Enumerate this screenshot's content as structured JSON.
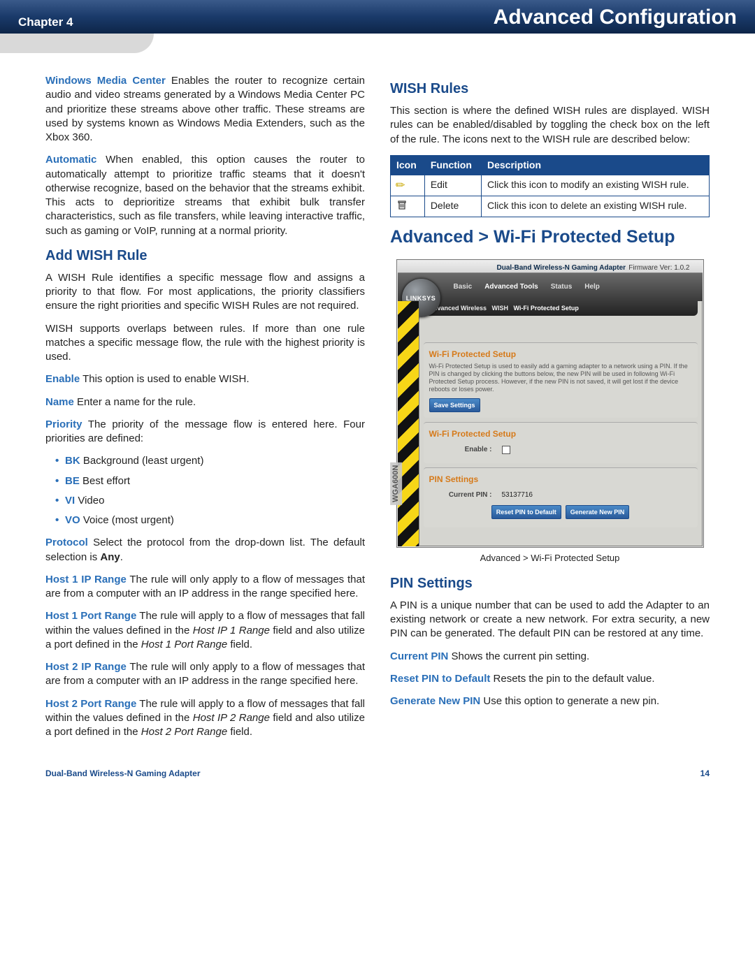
{
  "header": {
    "chapter": "Chapter 4",
    "title": "Advanced Configuration"
  },
  "left": {
    "wmc_label": "Windows Media Center",
    "wmc_text": "  Enables the router to recognize certain audio and video streams generated by a Windows Media Center PC and prioritize these streams above other traffic. These streams are used by systems known as Windows Media Extenders, such as the Xbox 360.",
    "auto_label": "Automatic",
    "auto_text": "  When enabled, this option causes the router to automatically attempt to prioritize traffic steams that it doesn't otherwise recognize, based on the behavior that the streams exhibit. This acts to deprioritize streams that exhibit bulk transfer characteristics, such as file transfers, while leaving interactive traffic, such as gaming or VoIP, running at a normal priority.",
    "add_heading": "Add WISH Rule",
    "add_p1": "A WISH Rule identifies a specific message flow and assigns a priority to that flow. For most applications, the priority classifiers ensure the right priorities and specific WISH Rules are not required.",
    "add_p2": "WISH supports overlaps between rules. If more than one rule matches a specific message flow, the rule with the highest priority is used.",
    "enable_label": "Enable",
    "enable_text": "  This option is used to enable WISH.",
    "name_label": "Name",
    "name_text": "  Enter a name for the rule.",
    "priority_label": "Priority",
    "priority_text": "  The priority of the message flow is entered here. Four priorities are defined:",
    "priorities": [
      {
        "abbr": "BK",
        "desc": "  Background (least urgent)"
      },
      {
        "abbr": "BE",
        "desc": "  Best effort"
      },
      {
        "abbr": "VI",
        "desc": "  Video"
      },
      {
        "abbr": "VO",
        "desc": "  Voice (most urgent)"
      }
    ],
    "protocol_label": "Protocol",
    "protocol_text_a": "  Select the protocol from the drop-down list. The default selection is ",
    "protocol_bold": "Any",
    "protocol_text_b": ".",
    "h1ip_label": "Host 1 IP Range",
    "h1ip_text": "  The rule will only apply to a flow of messages that are from a computer with an IP address in the range specified here.",
    "h1port_label": "Host 1 Port Range",
    "h1port_text_a": "  The rule will apply to a flow of messages that fall within the values defined in the ",
    "h1port_i1": "Host IP 1 Range",
    "h1port_text_b": " field and also utilize a port defined in the ",
    "h1port_i2": "Host 1 Port Range",
    "h1port_text_c": " field.",
    "h2ip_label": "Host 2 IP Range",
    "h2ip_text": "  The rule will only apply to a flow of messages that are from a computer with an IP address in the range specified here.",
    "h2port_label": "Host 2 Port Range",
    "h2port_text_a": "  The rule will apply to a flow of messages that fall within the values defined in the ",
    "h2port_i1": "Host IP 2 Range",
    "h2port_text_b": " field and also utilize a port defined in the ",
    "h2port_i2": "Host 2 Port Range",
    "h2port_text_c": " field."
  },
  "right": {
    "wish_heading": "WISH Rules",
    "wish_p": "This section is where the defined WISH rules are displayed. WISH rules can be enabled/disabled by toggling the check box on the left of the rule. The icons next to the WISH rule are described below:",
    "th_icon": "Icon",
    "th_func": "Function",
    "th_desc": "Description",
    "row_edit_func": "Edit",
    "row_edit_desc": "Click this icon to modify an existing WISH rule.",
    "row_del_func": "Delete",
    "row_del_desc": "Click this icon to delete an existing WISH rule.",
    "adv_heading": "Advanced > Wi-Fi Protected Setup",
    "ss_caption": "Advanced > Wi-Fi Protected Setup",
    "pin_heading": "PIN Settings",
    "pin_p": "A PIN is a unique number that can be used to add the Adapter to an existing network or create a new network. For extra security, a new PIN can be generated.  The default PIN can be restored at any time.",
    "cur_label": "Current PIN",
    "cur_text": "  Shows the current pin setting.",
    "reset_label": "Reset PIN to Default",
    "reset_text": "  Resets the pin to the default value.",
    "gen_label": "Generate New PIN",
    "gen_text": "  Use this option to generate a new pin."
  },
  "screenshot": {
    "device": "Dual-Band Wireless-N Gaming Adapter",
    "firmware": "Firmware Ver: 1.0.2",
    "logo": "LINKSYS",
    "nav": [
      "Basic",
      "Advanced Tools",
      "Status",
      "Help"
    ],
    "breadcrumb_a": "Advanced Wireless",
    "breadcrumb_b": "WISH",
    "breadcrumb_c": "Wi-Fi Protected Setup",
    "model": "WGA600N",
    "sec1_title": "Wi-Fi Protected Setup",
    "sec1_text": "Wi-Fi Protected Setup is used to easily add a gaming adapter to a network using a PIN. If the PIN is changed by clicking the buttons below, the new PIN will be used in following Wi-Fi Protected Setup process.\nHowever, if the new PIN is not saved, it will get lost if the device reboots or loses power.",
    "save_btn": "Save Settings",
    "sec2_title": "Wi-Fi Protected Setup",
    "enable_lbl": "Enable :",
    "sec3_title": "PIN Settings",
    "curpin_lbl": "Current PIN :",
    "curpin_val": "53137716",
    "btn_reset": "Reset PIN to Default",
    "btn_gen": "Generate New PIN"
  },
  "footer": {
    "left": "Dual-Band Wireless-N Gaming Adapter",
    "right": "14"
  }
}
